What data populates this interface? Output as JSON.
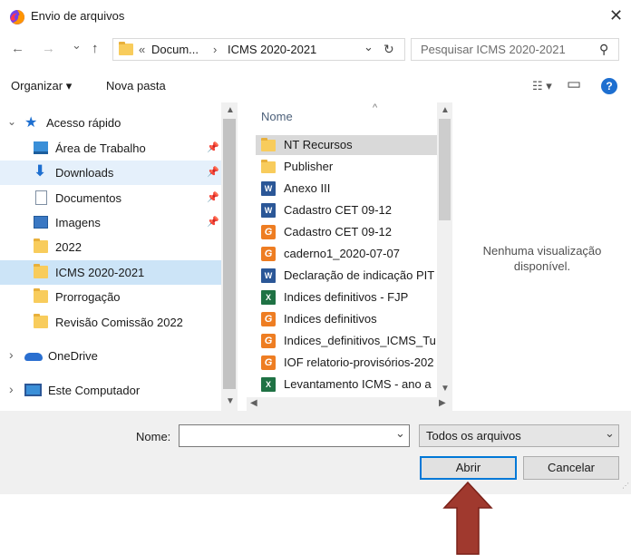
{
  "window": {
    "title": "Envio de arquivos",
    "close_glyph": "✕"
  },
  "address": {
    "back_glyph": "←",
    "forward_glyph": "→",
    "recent_glyph": "⌄",
    "up_glyph": "↑",
    "path_prefix": "«",
    "crumb1": "Docum...",
    "separator": "›",
    "crumb2": "ICMS 2020-2021",
    "dropdown_glyph": "⌄",
    "refresh_glyph": "↻"
  },
  "search": {
    "placeholder": "Pesquisar ICMS 2020-2021",
    "icon_glyph": "⚲"
  },
  "toolbar": {
    "organize_label": "Organizar ▾",
    "new_folder_label": "Nova pasta",
    "view_label": "☷ ▾",
    "pane_glyph": "▭",
    "help_glyph": "?"
  },
  "nav": {
    "items": [
      {
        "label": "Acesso rápido",
        "icon": "star-icon"
      },
      {
        "label": "Área de Trabalho",
        "icon": "desktop-icon",
        "pin": "📌"
      },
      {
        "label": "Downloads",
        "icon": "download-icon",
        "pin": "📌"
      },
      {
        "label": "Documentos",
        "icon": "documents-icon",
        "pin": "📌"
      },
      {
        "label": "Imagens",
        "icon": "pictures-icon",
        "pin": "📌"
      },
      {
        "label": "2022",
        "icon": "folder-icon"
      },
      {
        "label": "ICMS 2020-2021",
        "icon": "folder-icon"
      },
      {
        "label": "Prorrogação",
        "icon": "folder-icon"
      },
      {
        "label": "Revisão Comissão 2022",
        "icon": "folder-icon"
      },
      {
        "label": "OneDrive",
        "icon": "cloud-icon"
      },
      {
        "label": "Este Computador",
        "icon": "computer-icon"
      }
    ],
    "expanded_glyph": "⌄",
    "collapsed_glyph": "›"
  },
  "files": {
    "column_header": "Nome",
    "sort_glyph": "^",
    "items": [
      {
        "label": "NT Recursos",
        "icon": "folder-icon"
      },
      {
        "label": "Publisher",
        "icon": "folder-icon"
      },
      {
        "label": "Anexo III",
        "icon": "word-icon"
      },
      {
        "label": "Cadastro CET 09-12",
        "icon": "word-icon"
      },
      {
        "label": "Cadastro CET 09-12",
        "icon": "pdf-icon"
      },
      {
        "label": "caderno1_2020-07-07",
        "icon": "pdf-icon"
      },
      {
        "label": "Declaração de indicação PIT",
        "icon": "word-icon"
      },
      {
        "label": "Indices definitivos - FJP",
        "icon": "excel-icon"
      },
      {
        "label": "Indices definitivos",
        "icon": "pdf-icon"
      },
      {
        "label": "Indices_definitivos_ICMS_Tu",
        "icon": "pdf-icon"
      },
      {
        "label": "IOF relatorio-provisórios-202",
        "icon": "pdf-icon"
      },
      {
        "label": "Levantamento ICMS - ano a",
        "icon": "excel-icon"
      }
    ]
  },
  "preview": {
    "message_line1": "Nenhuma visualização",
    "message_line2": "disponível."
  },
  "footer": {
    "name_label": "Nome:",
    "name_value": "",
    "filter_value": "Todos os arquivos",
    "open_label": "Abrir",
    "cancel_label": "Cancelar",
    "combo_glyph": "⌄"
  },
  "colors": {
    "annotation_arrow": "#a0392e",
    "selection": "#cce4f7",
    "accent": "#0078d7"
  }
}
